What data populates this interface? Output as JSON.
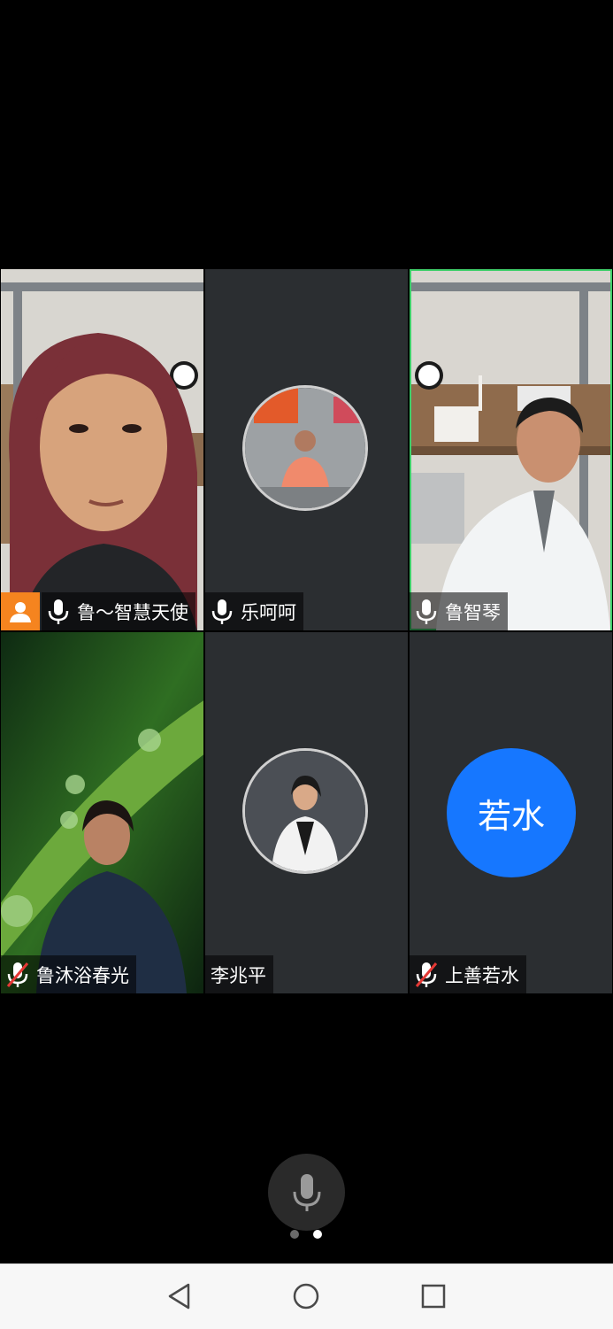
{
  "participants": [
    {
      "name": "鲁～智慧天使",
      "mic": "on",
      "host": true
    },
    {
      "name": "乐呵呵",
      "mic": "on"
    },
    {
      "name": "鲁智琴",
      "mic": "on",
      "speaking": true
    },
    {
      "name": "鲁沐浴春光",
      "mic": "muted"
    },
    {
      "name": "李兆平",
      "mic": "none"
    },
    {
      "name": "上善若水",
      "mic": "muted",
      "avatar_text": "若水"
    }
  ],
  "controls": {
    "mic_icon": "microphone-icon",
    "pages": 2,
    "current_page": 2
  },
  "nav": {
    "back_icon": "back-triangle-icon",
    "home_icon": "home-circle-icon",
    "recents_icon": "recents-square-icon"
  },
  "colors": {
    "host_badge": "#f5841f",
    "speaking_border": "#3fcf6a",
    "avatar_blue": "#1677ff"
  }
}
